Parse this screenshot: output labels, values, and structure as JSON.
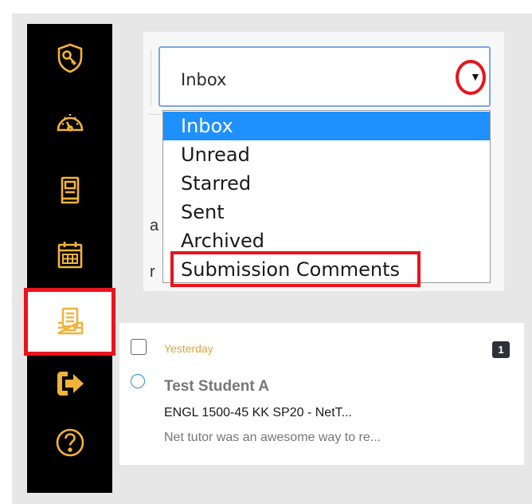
{
  "colors": {
    "accent": "#f2b33a",
    "highlight": "#e8141e",
    "selected": "#1e90ff",
    "sidebar": "#000000"
  },
  "sidebar": {
    "items": [
      {
        "icon": "shield-key-icon"
      },
      {
        "icon": "dashboard-gauge-icon"
      },
      {
        "icon": "book-icon"
      },
      {
        "icon": "calendar-icon"
      },
      {
        "icon": "inbox-tray-icon"
      },
      {
        "icon": "logout-arrow-icon"
      },
      {
        "icon": "help-icon"
      }
    ]
  },
  "mailbox_select": {
    "value": "Inbox",
    "arrow": "▼",
    "options": [
      "Inbox",
      "Unread",
      "Starred",
      "Sent",
      "Archived",
      "Submission Comments"
    ],
    "selected_index": 0
  },
  "background_fragments": {
    "frag_1": "a",
    "frag_2": "r"
  },
  "conversation": {
    "date": "Yesterday",
    "count": "1",
    "sender": "Test Student A",
    "subject": "ENGL 1500-45 KK SP20 - NetT...",
    "preview": "Net tutor was an awesome way to re..."
  }
}
